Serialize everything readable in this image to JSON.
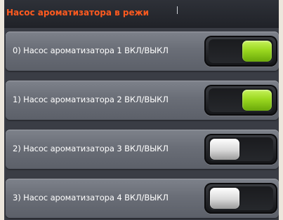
{
  "header": {
    "title": "Насос ароматизатора в режи",
    "title_color": "#ff5a1f"
  },
  "rows": [
    {
      "label": "0) Насос ароматизатора 1 ВКЛ/ВЫКЛ",
      "state": "on"
    },
    {
      "label": "1) Насос ароматизатора 2 ВКЛ/ВЫКЛ",
      "state": "on"
    },
    {
      "label": "2) Насос ароматизатора 3 ВКЛ/ВЫКЛ",
      "state": "off"
    },
    {
      "label": "3) Насос ароматизатора 4 ВКЛ/ВЫКЛ",
      "state": "off"
    }
  ],
  "colors": {
    "toggle_on": "#9bd820",
    "toggle_off": "#d8d8d8",
    "row_background": "#6a6e77"
  }
}
